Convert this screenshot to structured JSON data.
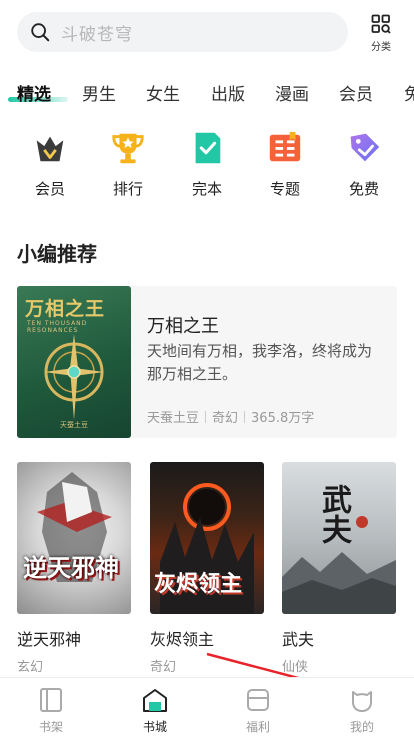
{
  "search": {
    "placeholder": "斗破苍穹"
  },
  "category_button": {
    "label": "分类"
  },
  "tabs": [
    "精选",
    "男生",
    "女生",
    "出版",
    "漫画",
    "会员",
    "免"
  ],
  "quick_icons": [
    {
      "label": "会员",
      "icon": "vip-crown-icon",
      "color": "#3b3b3b"
    },
    {
      "label": "排行",
      "icon": "trophy-icon",
      "color": "#f5b21a"
    },
    {
      "label": "完本",
      "icon": "completed-check-icon",
      "color": "#22c7a5"
    },
    {
      "label": "专题",
      "icon": "topic-book-icon",
      "color": "#f5623a"
    },
    {
      "label": "免费",
      "icon": "free-tag-icon",
      "color": "#7a6cf0"
    }
  ],
  "section": {
    "title": "小编推荐"
  },
  "featured": {
    "title": "万相之王",
    "description": "天地间有万相，我李洛，终将成为那万相之王。",
    "author": "天蚕土豆",
    "genre": "奇幻",
    "word_count": "365.8万字",
    "cover_title": "万相之王",
    "cover_subtitle": "TEN THOUSAND RESONANCES",
    "cover_author": "天蚕土豆"
  },
  "books": [
    {
      "title": "逆天邪神",
      "genre": "玄幻",
      "cover_text": "逆天邪神"
    },
    {
      "title": "灰烬领主",
      "genre": "奇幻",
      "cover_text": "灰烬领主"
    },
    {
      "title": "武夫",
      "genre": "仙侠",
      "cover_text": "武夫"
    }
  ],
  "bottom_nav": [
    {
      "label": "书架",
      "icon": "bookshelf-icon",
      "active": false
    },
    {
      "label": "书城",
      "icon": "bookstore-icon",
      "active": true
    },
    {
      "label": "福利",
      "icon": "welfare-icon",
      "active": false
    },
    {
      "label": "我的",
      "icon": "profile-icon",
      "active": false
    }
  ],
  "colors": {
    "accent": "#22c7a5",
    "annotation_arrow": "#e8232a"
  }
}
